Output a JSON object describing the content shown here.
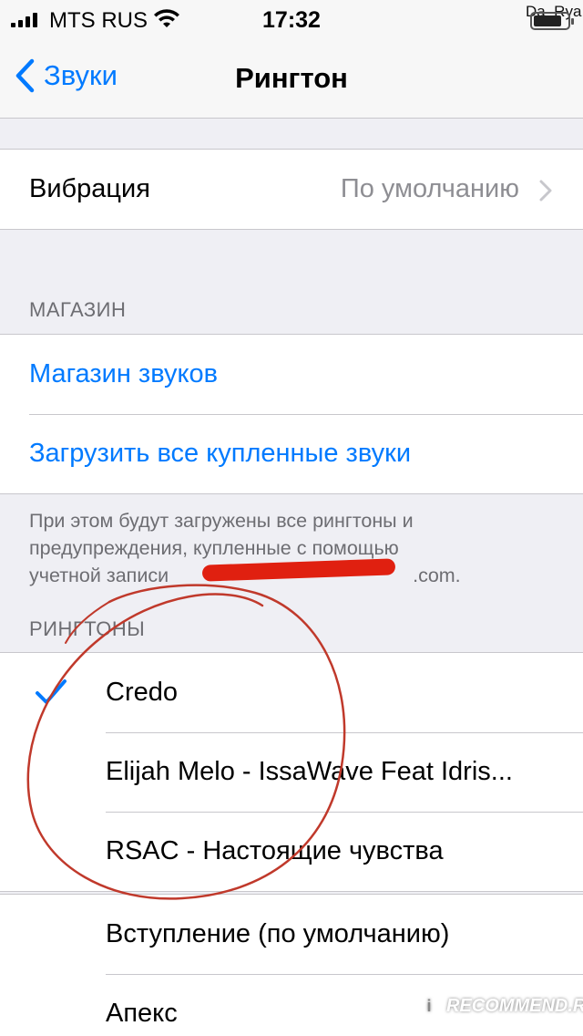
{
  "status_bar": {
    "carrier": "MTS RUS",
    "time": "17:32",
    "watermark_user": "Da_Rya"
  },
  "nav": {
    "back_label": "Звуки",
    "title": "Рингтон"
  },
  "vibration": {
    "label": "Вибрация",
    "value": "По умолчанию"
  },
  "store": {
    "header": "МАГАЗИН",
    "items": [
      {
        "label": "Магазин звуков"
      },
      {
        "label": "Загрузить все купленные звуки"
      }
    ],
    "footer": {
      "line1": "При этом будут загружены все рингтоны и",
      "line2": "предупреждения, купленные с помощью",
      "line3_prefix": "учетной записи",
      "line3_suffix": ".com."
    }
  },
  "ringtones": {
    "header": "РИНГТОНЫ",
    "items": [
      {
        "label": "Credo",
        "selected": true
      },
      {
        "label": "Elijah Melo - IssaWave Feat Idris..."
      },
      {
        "label": "RSAC - Настоящие чувства"
      }
    ]
  },
  "system_tones": {
    "items": [
      {
        "label": "Вступление (по умолчанию)"
      },
      {
        "label": "Апекс"
      }
    ]
  },
  "watermark": {
    "text": "RECOMMEND.RU",
    "badge": "i"
  },
  "colors": {
    "accent": "#007aff",
    "annotation": "#c0392b",
    "background": "#efeff4"
  }
}
